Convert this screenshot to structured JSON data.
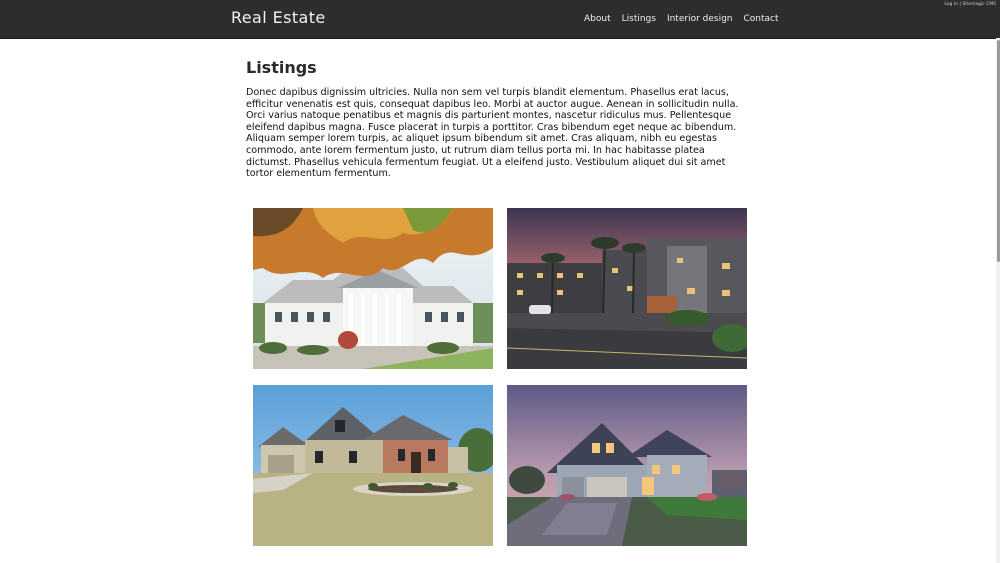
{
  "header": {
    "brand": "Real Estate",
    "nav": [
      "About",
      "Listings",
      "Interior design",
      "Contact"
    ],
    "login": "Log in",
    "separator": "|",
    "cms": "Sitemagic CMS"
  },
  "main": {
    "title": "Listings",
    "intro": "Donec dapibus dignissim ultricies. Nulla non sem vel turpis blandit elementum. Phasellus erat lacus, efficitur venenatis est quis, consequat dapibus leo. Morbi at auctor augue. Aenean in sollicitudin nulla. Orci varius natoque penatibus et magnis dis parturient montes, nascetur ridiculus mus. Pellentesque eleifend dapibus magna. Fusce placerat in turpis a porttitor. Cras bibendum eget neque ac bibendum. Aliquam semper lorem turpis, ac aliquet ipsum bibendum sit amet. Cras aliquam, nibh eu egestas commodo, ante lorem fermentum justo, ut rutrum diam tellus porta mi. In hac habitasse platea dictumst. Phasellus vehicula fermentum feugiat. Ut a eleifend justo. Vestibulum aliquet dui sit amet tortor elementum fermentum."
  },
  "colors": {
    "header_bg": "#2d2d2d",
    "header_text": "#f2f2f2"
  }
}
